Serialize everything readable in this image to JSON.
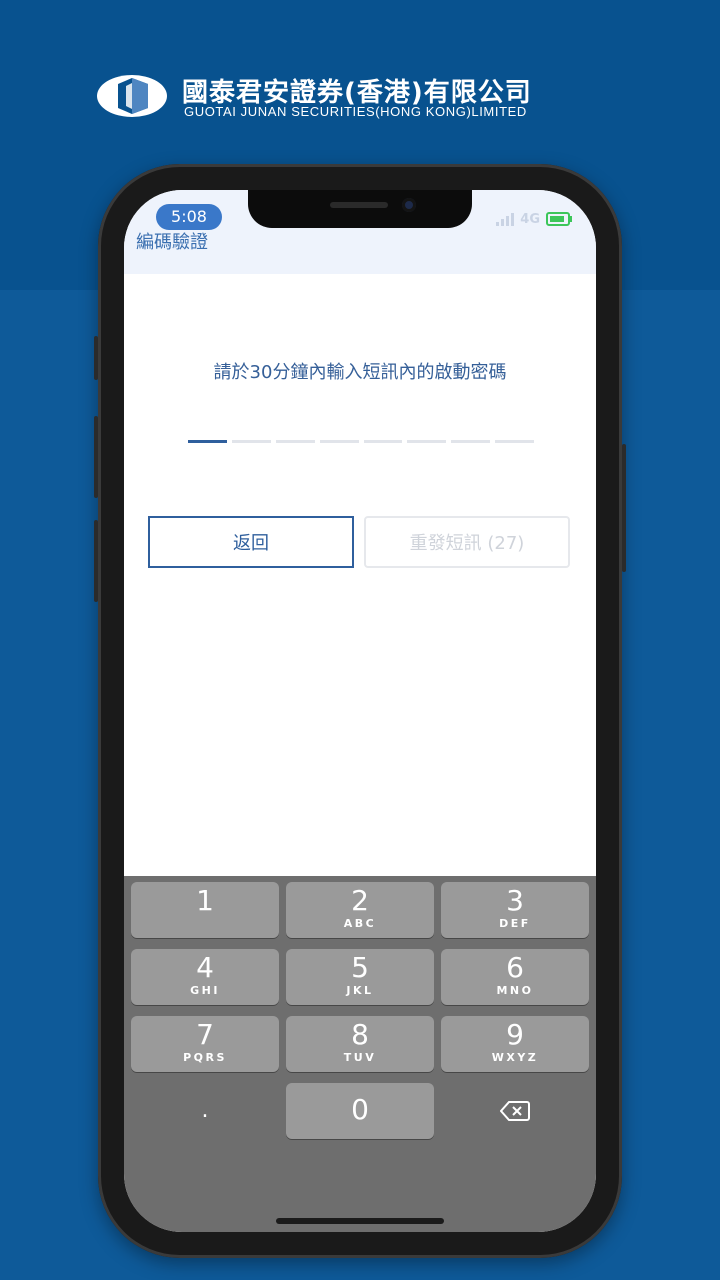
{
  "brand": {
    "name_cn": "國泰君安證券(香港)有限公司",
    "name_en": "GUOTAI JUNAN SECURITIES(HONG KONG)LIMITED",
    "logo_icon": "gtja-logo-icon"
  },
  "status_bar": {
    "time": "5:08",
    "network": "4G",
    "battery_color": "#3cc65a"
  },
  "header": {
    "title": "編碼驗證"
  },
  "main": {
    "instruction": "請於30分鐘內輸入短訊內的啟動密碼",
    "code_length": 8,
    "code_value": "",
    "back_label": "返回",
    "resend_label": "重發短訊 (27)"
  },
  "keyboard": {
    "keys": [
      {
        "num": "1",
        "sub": ""
      },
      {
        "num": "2",
        "sub": "ABC"
      },
      {
        "num": "3",
        "sub": "DEF"
      },
      {
        "num": "4",
        "sub": "GHI"
      },
      {
        "num": "5",
        "sub": "JKL"
      },
      {
        "num": "6",
        "sub": "MNO"
      },
      {
        "num": "7",
        "sub": "PQRS"
      },
      {
        "num": "8",
        "sub": "TUV"
      },
      {
        "num": "9",
        "sub": "WXYZ"
      }
    ],
    "dot": ".",
    "zero": "0",
    "backspace_icon": "backspace-icon"
  },
  "colors": {
    "brand_blue": "#08528f",
    "accent": "#2f5f9d"
  }
}
